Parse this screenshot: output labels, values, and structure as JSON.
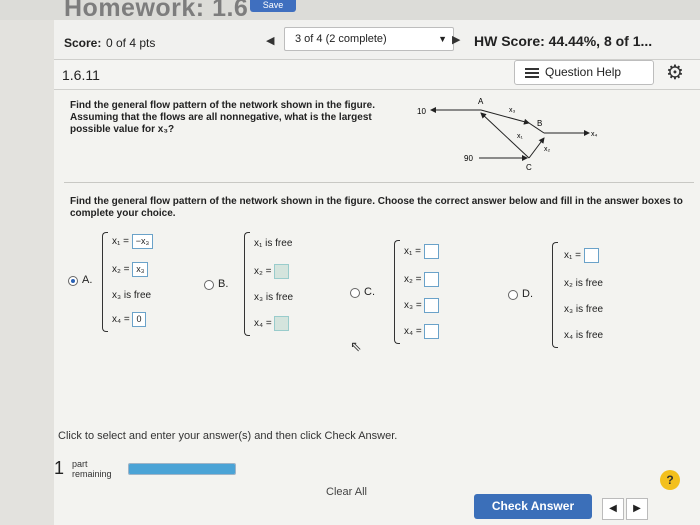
{
  "header": {
    "title": "Homework: 1.6",
    "save_label": "Save",
    "score_label": "Score:",
    "score_value": "0 of 4 pts",
    "nav_position": "3 of 4 (2 complete)",
    "hw_score": "HW Score: 44.44%, 8 of 1..."
  },
  "question": {
    "number": "1.6.11",
    "help_label": "Question Help",
    "text": "Find the general flow pattern of the network shown in the figure. Assuming that the flows are all nonnegative, what is the largest possible value for x₃?",
    "instruction": "Find the general flow pattern of the network shown in the figure. Choose the correct answer below and fill in the answer boxes to complete your choice."
  },
  "diagram": {
    "labels": {
      "in_top": "10",
      "in_bottom": "90",
      "node_a": "A",
      "node_b": "B",
      "node_c": "C",
      "x1": "x₁",
      "x2": "x₂",
      "x3": "x₃",
      "x4": "x₄"
    }
  },
  "options": {
    "a": {
      "letter": "A.",
      "selected": true,
      "r1_label": "x₁ =",
      "r1_value": "−x₃",
      "r2_label": "x₂ =",
      "r2_value": "x₃",
      "r3_text": "x₃ is free",
      "r4_label": "x₄ =",
      "r4_value": "0"
    },
    "b": {
      "letter": "B.",
      "r1_text": "x₁ is free",
      "r2_label": "x₂ =",
      "r3_text": "x₃ is free",
      "r4_label": "x₄ ="
    },
    "c": {
      "letter": "C.",
      "r1_label": "x₁ =",
      "r2_label": "x₂ =",
      "r3_label": "x₃ =",
      "r4_label": "x₄ ="
    },
    "d": {
      "letter": "D.",
      "r1_label": "x₁ =",
      "r2_text": "x₂ is free",
      "r3_text": "x₃ is free",
      "r4_text": "x₄ is free"
    }
  },
  "footer": {
    "click_text": "Click to select and enter your answer(s) and then click Check Answer.",
    "part_number": "1",
    "part_label_1": "part",
    "part_label_2": "remaining",
    "progress_fraction": 1.0,
    "clear_label": "Clear All",
    "check_label": "Check Answer",
    "help_symbol": "?"
  },
  "colors": {
    "accent": "#3b6fb9",
    "progress": "#4aa3d6",
    "help": "#f3c01d"
  }
}
